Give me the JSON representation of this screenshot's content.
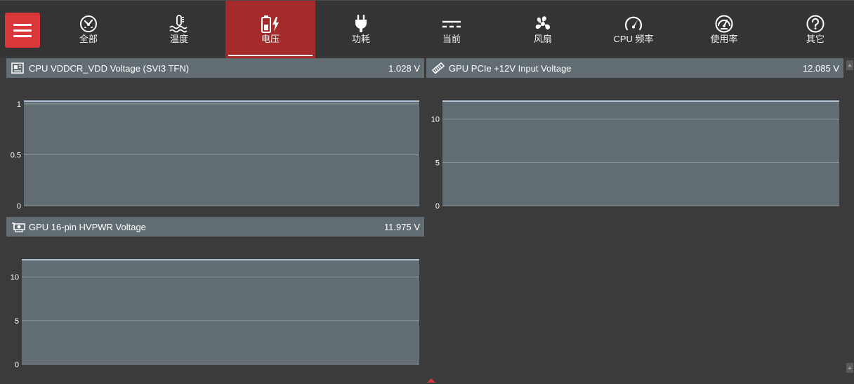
{
  "nav": {
    "menu_icon": "hamburger-icon",
    "tabs": [
      {
        "label": "全部",
        "icon": "wrench-gauge-icon",
        "active": false
      },
      {
        "label": "温度",
        "icon": "thermometer-icon",
        "active": false
      },
      {
        "label": "电压",
        "icon": "battery-bolt-icon",
        "active": true
      },
      {
        "label": "功耗",
        "icon": "plug-icon",
        "active": false
      },
      {
        "label": "当前",
        "icon": "dc-current-icon",
        "active": false
      },
      {
        "label": "风扇",
        "icon": "fan-icon",
        "active": false
      },
      {
        "label": "CPU 频率",
        "icon": "speedometer-icon",
        "active": false
      },
      {
        "label": "使用率",
        "icon": "gauge-dial-icon",
        "active": false
      },
      {
        "label": "其它",
        "icon": "question-icon",
        "active": false
      }
    ]
  },
  "panels": [
    {
      "title": "CPU VDDCR_VDD Voltage (SVI3 TFN)",
      "value": "1.028 V",
      "icon": "motherboard-icon"
    },
    {
      "title": "GPU PCIe +12V Input Voltage",
      "value": "12.085 V",
      "icon": "pcie-card-icon"
    },
    {
      "title": "GPU 16-pin HVPWR Voltage",
      "value": "11.975 V",
      "icon": "gpu-card-icon"
    }
  ],
  "colors": {
    "accent": "#d9373a",
    "active_tab": "#a52a2a",
    "panel_header": "#626d73",
    "chart_bg": "#636e74",
    "line": "#cfe6ff"
  },
  "chart_data": [
    {
      "type": "area",
      "title": "CPU VDDCR_VDD Voltage (SVI3 TFN)",
      "ylim": [
        0,
        1.028
      ],
      "yticks": [
        0,
        0.5,
        1
      ],
      "ytick_labels": [
        "0",
        "0.5",
        "1"
      ],
      "grid": true,
      "series": [
        {
          "values": [
            1.028,
            1.028,
            1.028,
            1.028,
            1.028,
            1.028,
            1.028,
            1.028,
            1.028,
            1.028
          ]
        }
      ]
    },
    {
      "type": "area",
      "title": "GPU PCIe +12V Input Voltage",
      "ylim": [
        0,
        12.085
      ],
      "yticks": [
        0,
        5,
        10
      ],
      "ytick_labels": [
        "0",
        "5",
        "10"
      ],
      "grid": true,
      "series": [
        {
          "values": [
            12.085,
            12.085,
            12.085,
            12.085,
            12.085,
            12.085,
            12.085,
            12.085,
            12.085,
            12.085
          ]
        }
      ]
    },
    {
      "type": "area",
      "title": "GPU 16-pin HVPWR Voltage",
      "ylim": [
        0,
        11.975
      ],
      "yticks": [
        0,
        5,
        10
      ],
      "ytick_labels": [
        "0",
        "5",
        "10"
      ],
      "grid": true,
      "series": [
        {
          "values": [
            11.975,
            11.975,
            11.975,
            11.975,
            11.975,
            11.975,
            11.975,
            11.975,
            11.975,
            11.975
          ]
        }
      ]
    }
  ]
}
